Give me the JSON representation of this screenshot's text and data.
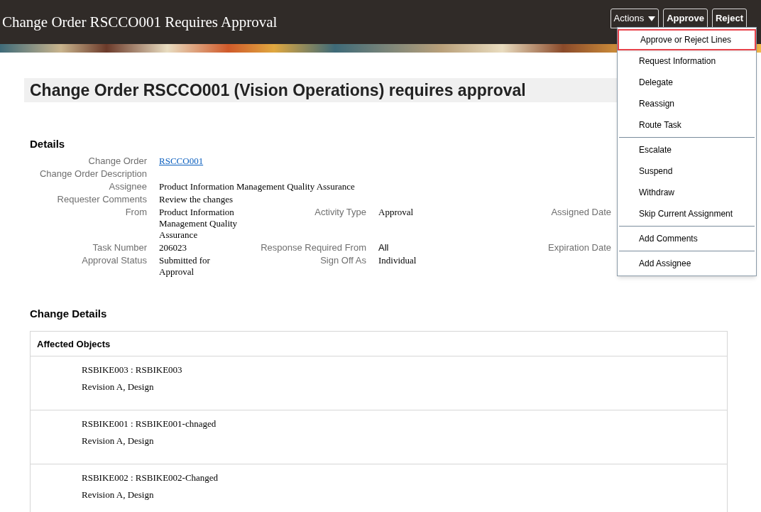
{
  "header": {
    "title": "Change Order RSCCO001 Requires Approval",
    "actions_button": {
      "label": "Actions",
      "expanded": true
    },
    "buttons": [
      "Approve",
      "Reject"
    ]
  },
  "actions_menu": {
    "groups": [
      [
        {
          "label": "Approve or Reject Lines",
          "selected": true
        },
        {
          "label": "Request Information",
          "selected": false
        },
        {
          "label": "Delegate",
          "selected": false
        },
        {
          "label": "Reassign",
          "selected": false
        },
        {
          "label": "Route Task",
          "selected": false
        }
      ],
      [
        {
          "label": "Escalate",
          "selected": false
        },
        {
          "label": "Suspend",
          "selected": false
        },
        {
          "label": "Withdraw",
          "selected": false
        },
        {
          "label": "Skip Current Assignment",
          "selected": false
        }
      ],
      [
        {
          "label": "Add Comments",
          "selected": false
        }
      ],
      [
        {
          "label": "Add Assignee",
          "selected": false
        }
      ]
    ]
  },
  "page_heading": "Change Order RSCCO001 (Vision Operations) requires approval",
  "details": {
    "title": "Details",
    "rows": [
      {
        "left": {
          "label": "Change Order",
          "value": "RSCCO001",
          "kind": "link"
        }
      },
      {
        "left": {
          "label": "Change Order Description"
        }
      },
      {
        "left": {
          "label": "Assignee",
          "value": "Product Information Management Quality Assurance",
          "kind": "serif"
        }
      },
      {
        "left": {
          "label": "Requester Comments",
          "value": "Review the changes",
          "kind": "serif"
        }
      },
      {
        "left": {
          "label": "From",
          "value": "Product Information Management Quality Assurance",
          "kind": "serif"
        },
        "middle": {
          "label": "Activity Type",
          "value": "Approval",
          "kind": "serif"
        },
        "right": {
          "label": "Assigned Date"
        }
      },
      {
        "left": {
          "label": "Task Number",
          "value": "206023",
          "kind": "serif"
        },
        "middle": {
          "label": "Response Required From",
          "value": "All",
          "kind": "sans"
        },
        "right": {
          "label": "Expiration Date"
        }
      },
      {
        "left": {
          "label": "Approval Status",
          "value": "Submitted for Approval",
          "kind": "serif"
        },
        "middle": {
          "label": "Sign Off As",
          "value": "Individual",
          "kind": "serif"
        }
      }
    ]
  },
  "change_details": {
    "title": "Change Details",
    "table_title": "Affected Objects",
    "objects": [
      {
        "name": "RSBIKE003 : RSBIKE003",
        "revision": "Revision A, Design"
      },
      {
        "name": "RSBIKE001 : RSBIKE001-chnaged",
        "revision": "Revision A, Design"
      },
      {
        "name": "RSBIKE002 : RSBIKE002-Changed",
        "revision": "Revision A, Design"
      }
    ]
  }
}
